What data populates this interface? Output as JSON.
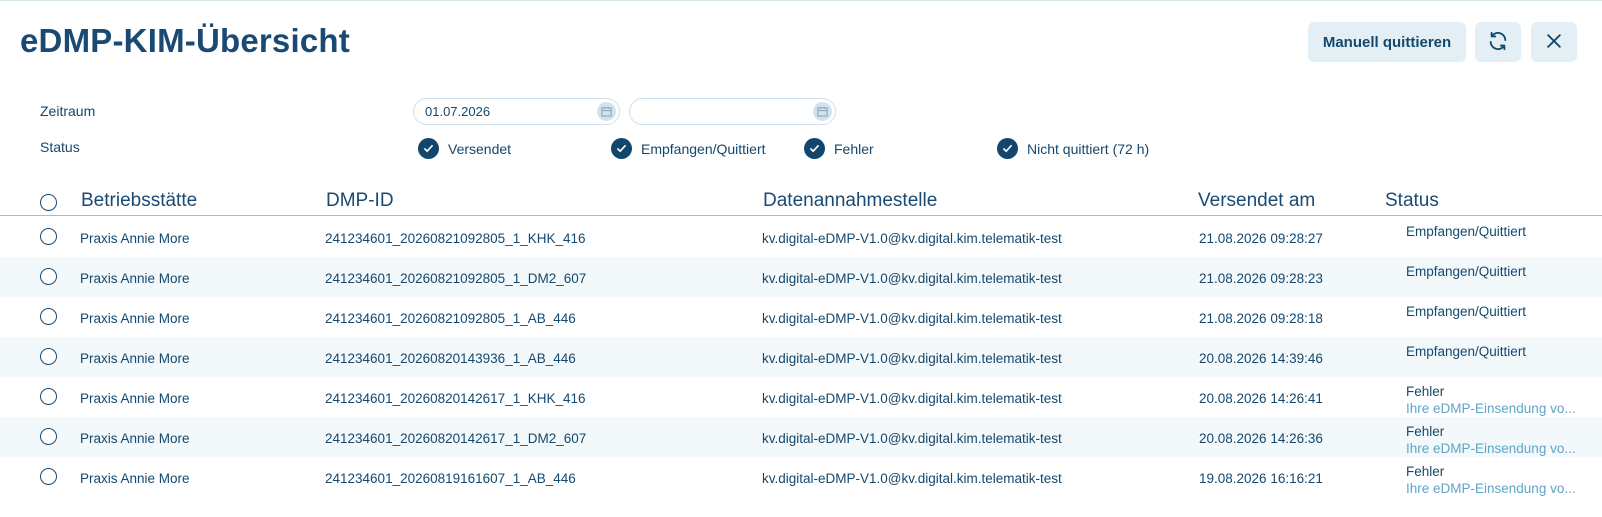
{
  "header": {
    "title": "eDMP-KIM-Übersicht",
    "manual_ack_label": "Manuell quittieren",
    "refresh_icon": "refresh-icon",
    "close_icon": "close-icon"
  },
  "filters": {
    "period_label": "Zeitraum",
    "date_from": "01.07.2026",
    "date_to": "",
    "status_label": "Status",
    "status_options": [
      {
        "label": "Versendet",
        "checked": true
      },
      {
        "label": "Empfangen/Quittiert",
        "checked": true
      },
      {
        "label": "Fehler",
        "checked": true
      },
      {
        "label": "Nicht quittiert (72 h)",
        "checked": true
      }
    ]
  },
  "table": {
    "columns": [
      "Betriebsstätte",
      "DMP-ID",
      "Datenannahmestelle",
      "Versendet am",
      "Status"
    ],
    "rows": [
      {
        "site": "Praxis Annie More",
        "dmp_id": "241234601_20260821092805_1_KHK_416",
        "receiver": "kv.digital-eDMP-V1.0@kv.digital.kim.telematik-test",
        "sent": "21.08.2026 09:28:27",
        "status": "Empfangen/Quittiert",
        "message": ""
      },
      {
        "site": "Praxis Annie More",
        "dmp_id": "241234601_20260821092805_1_DM2_607",
        "receiver": "kv.digital-eDMP-V1.0@kv.digital.kim.telematik-test",
        "sent": "21.08.2026 09:28:23",
        "status": "Empfangen/Quittiert",
        "message": ""
      },
      {
        "site": "Praxis Annie More",
        "dmp_id": "241234601_20260821092805_1_AB_446",
        "receiver": "kv.digital-eDMP-V1.0@kv.digital.kim.telematik-test",
        "sent": "21.08.2026 09:28:18",
        "status": "Empfangen/Quittiert",
        "message": ""
      },
      {
        "site": "Praxis Annie More",
        "dmp_id": "241234601_20260820143936_1_AB_446",
        "receiver": "kv.digital-eDMP-V1.0@kv.digital.kim.telematik-test",
        "sent": "20.08.2026 14:39:46",
        "status": "Empfangen/Quittiert",
        "message": ""
      },
      {
        "site": "Praxis Annie More",
        "dmp_id": "241234601_20260820142617_1_KHK_416",
        "receiver": "kv.digital-eDMP-V1.0@kv.digital.kim.telematik-test",
        "sent": "20.08.2026 14:26:41",
        "status": "Fehler",
        "message": "Ihre eDMP-Einsendung vo..."
      },
      {
        "site": "Praxis Annie More",
        "dmp_id": "241234601_20260820142617_1_DM2_607",
        "receiver": "kv.digital-eDMP-V1.0@kv.digital.kim.telematik-test",
        "sent": "20.08.2026 14:26:36",
        "status": "Fehler",
        "message": "Ihre eDMP-Einsendung vo..."
      },
      {
        "site": "Praxis Annie More",
        "dmp_id": "241234601_20260819161607_1_AB_446",
        "receiver": "kv.digital-eDMP-V1.0@kv.digital.kim.telematik-test",
        "sent": "19.08.2026 16:16:21",
        "status": "Fehler",
        "message": "Ihre eDMP-Einsendung vo..."
      }
    ]
  },
  "colors": {
    "primary": "#14486e",
    "button_bg": "#e3eff5",
    "row_alt": "#f3f8fa",
    "message": "#5fa5c8"
  }
}
